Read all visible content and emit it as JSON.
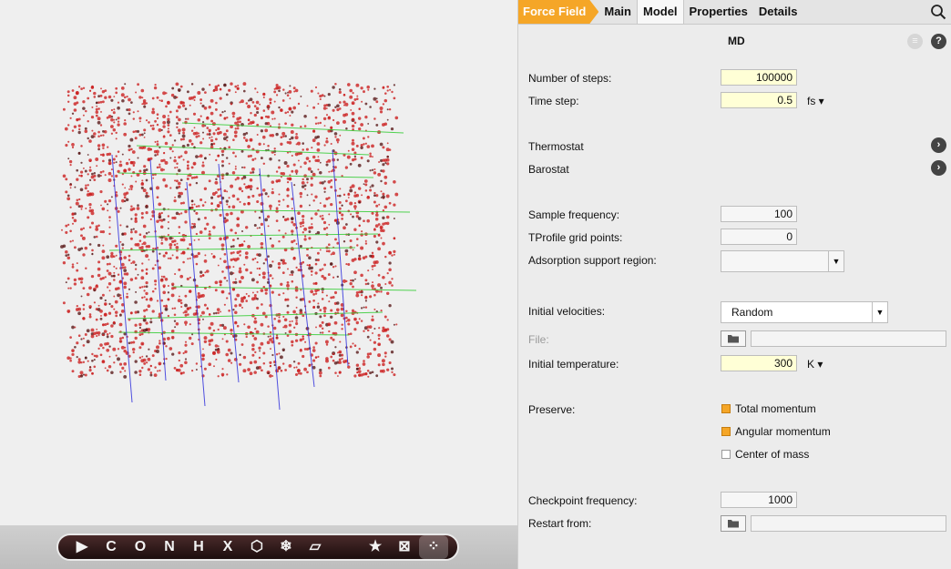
{
  "viewport": {
    "atom_color": "#cc2020",
    "axis_x_color": "#33cc33",
    "axis_y_color": "#3333dd"
  },
  "toolbar": [
    {
      "name": "select-tool",
      "glyph": "▶"
    },
    {
      "name": "carbon-tool",
      "glyph": "C"
    },
    {
      "name": "oxygen-tool",
      "glyph": "O"
    },
    {
      "name": "nitrogen-tool",
      "glyph": "N"
    },
    {
      "name": "hydrogen-tool",
      "glyph": "H"
    },
    {
      "name": "element-picker-tool",
      "glyph": "X"
    },
    {
      "name": "ring-tool",
      "glyph": "⬡"
    },
    {
      "name": "freeze-tool",
      "glyph": "❄"
    },
    {
      "name": "plane-tool",
      "glyph": "▱"
    }
  ],
  "toolbar_right": [
    {
      "name": "favorites-tool",
      "glyph": "★"
    },
    {
      "name": "box-view-tool",
      "glyph": "⊠"
    },
    {
      "name": "molecules-tool",
      "glyph": "⁘"
    }
  ],
  "tabs": {
    "force_field": "Force Field",
    "main": "Main",
    "model": "Model",
    "properties": "Properties",
    "details": "Details"
  },
  "panel": {
    "title": "MD",
    "number_of_steps_label": "Number of steps:",
    "number_of_steps": "100000",
    "time_step_label": "Time step:",
    "time_step": "0.5",
    "time_step_unit": "fs ▾",
    "thermostat_label": "Thermostat",
    "barostat_label": "Barostat",
    "sample_frequency_label": "Sample frequency:",
    "sample_frequency": "100",
    "tprofile_label": "TProfile grid points:",
    "tprofile": "0",
    "adsorption_label": "Adsorption support region:",
    "adsorption_value": "",
    "initial_velocities_label": "Initial velocities:",
    "initial_velocities": "Random",
    "file_label": "File:",
    "initial_temperature_label": "Initial temperature:",
    "initial_temperature": "300",
    "temperature_unit": "K ▾",
    "preserve_label": "Preserve:",
    "total_momentum": "Total momentum",
    "angular_momentum": "Angular momentum",
    "center_of_mass": "Center of mass",
    "checkpoint_label": "Checkpoint frequency:",
    "checkpoint": "1000",
    "restart_label": "Restart from:"
  }
}
